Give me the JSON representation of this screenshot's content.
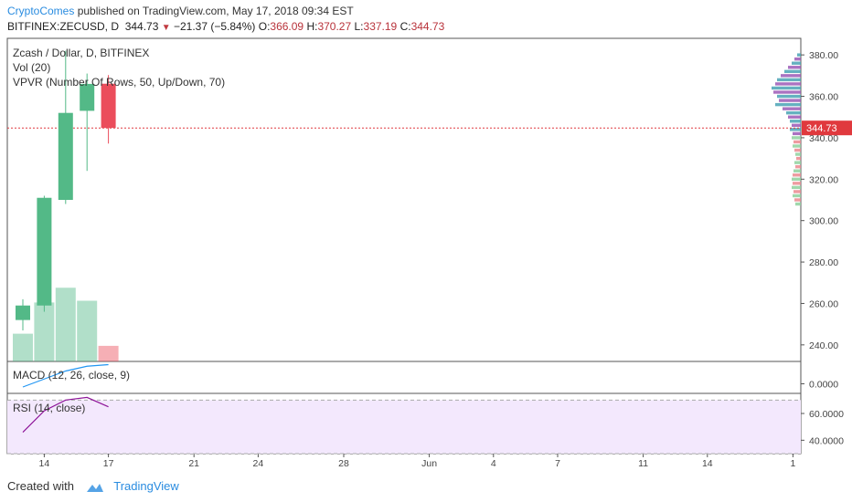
{
  "header": {
    "author": "CryptoComes",
    "published": "published on TradingView.com, May 17, 2018 09:34 EST",
    "symbol": "BITFINEX:ZECUSD, D",
    "last": "344.73",
    "change": "−21.37 (−5.84%)",
    "o_label": "O:",
    "o": "366.09",
    "h_label": "H:",
    "h": "370.27",
    "l_label": "L:",
    "l": "337.19",
    "c_label": "C:",
    "c": "344.73"
  },
  "labels": {
    "title": "Zcash / Dollar, D, BITFINEX",
    "vol": "Vol (20)",
    "vpvr": "VPVR (Number Of Rows, 50, Up/Down, 70)",
    "macd": "MACD (12, 26, close, 9)",
    "rsi": "RSI (14, close)"
  },
  "footer": {
    "created": "Created with",
    "brand": "TradingView"
  },
  "colors": {
    "up": "#53b987",
    "down": "#eb4d5c",
    "last_line": "#e0393e",
    "rsi_bg": "#f3e8fd",
    "rsi_line": "#8e1599",
    "macd_line": "#2196f3"
  },
  "chart_data": {
    "type": "candlestick",
    "price_axis": {
      "ticks": [
        "380.00",
        "360.00",
        "340.00",
        "320.00",
        "300.00",
        "280.00",
        "260.00",
        "240.00"
      ],
      "range": [
        232,
        388
      ]
    },
    "last_price_label": "344.73",
    "x_ticks": [
      "14",
      "17",
      "21",
      "24",
      "28",
      "Jun",
      "4",
      "7",
      "11",
      "14",
      "1"
    ],
    "candles": [
      {
        "date": "May 13",
        "o": 252,
        "h": 262,
        "l": 247,
        "c": 259
      },
      {
        "date": "May 14",
        "o": 259,
        "h": 312,
        "l": 256,
        "c": 311
      },
      {
        "date": "May 15",
        "o": 310,
        "h": 382,
        "l": 308,
        "c": 352
      },
      {
        "date": "May 16",
        "o": 353,
        "h": 371,
        "l": 324,
        "c": 366
      },
      {
        "date": "May 17",
        "o": 366.09,
        "h": 370.27,
        "l": 337.19,
        "c": 344.73
      }
    ],
    "volume_rel": [
      0.32,
      0.68,
      0.85,
      0.7,
      0.18
    ],
    "macd": {
      "ticks": [
        "0.0000"
      ],
      "line": [
        -2,
        3,
        8,
        11,
        12
      ],
      "range": [
        -6,
        14
      ]
    },
    "rsi": {
      "ticks": [
        "60.0000",
        "40.0000"
      ],
      "values": [
        46,
        62,
        70,
        72,
        65
      ],
      "range": [
        30,
        75
      ],
      "bands": [
        70,
        30
      ]
    }
  }
}
